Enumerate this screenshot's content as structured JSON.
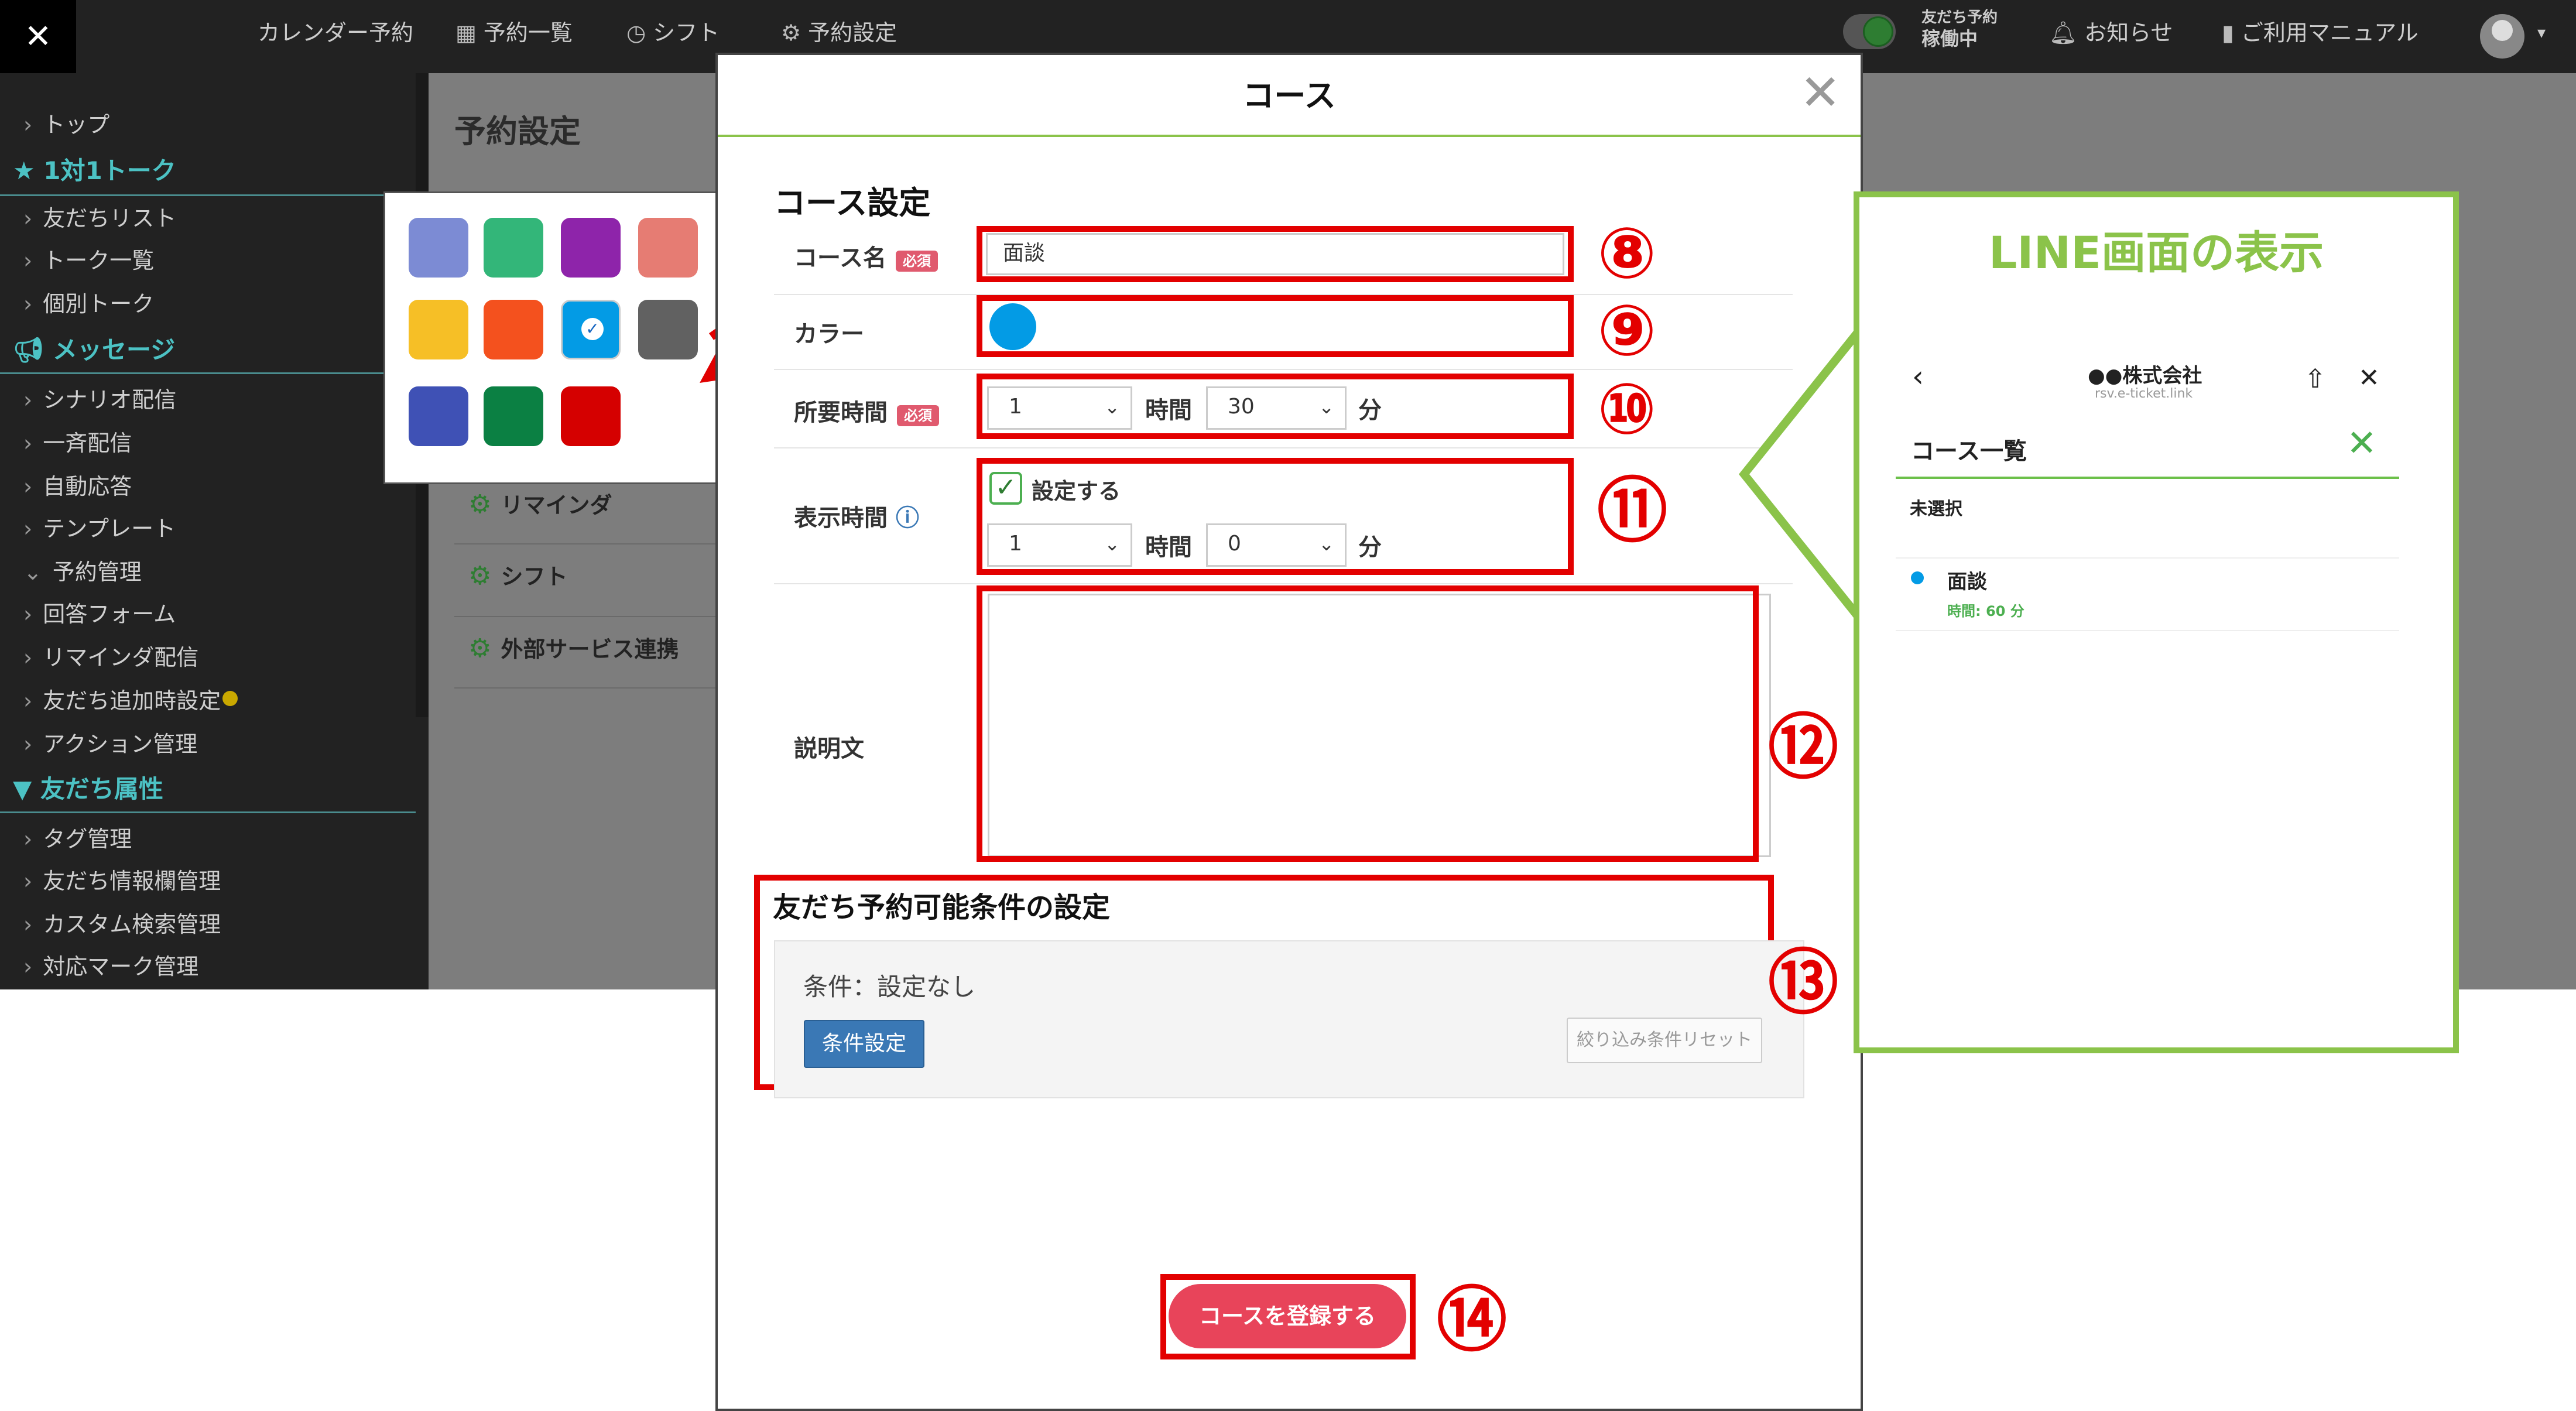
{
  "topbar": {
    "close_icon": "close-x-icon",
    "nav": [
      {
        "label": "カレンダー予約",
        "icon": ""
      },
      {
        "label": "予約一覧",
        "icon": "calendar-grid-icon"
      },
      {
        "label": "シフト",
        "icon": "clock-icon"
      },
      {
        "label": "予約設定",
        "icon": "gear-icon"
      }
    ],
    "status_line1": "友だち予約",
    "status_line2": "稼働中",
    "notice": "お知らせ",
    "manual": "ご利用マニュアル"
  },
  "sidebar": {
    "items_top": [
      "トップ"
    ],
    "section1": "1対1トーク",
    "section1_items": [
      "友だちリスト",
      "トーク一覧",
      "個別トーク"
    ],
    "section2": "メッセージ",
    "section2_items": [
      "シナリオ配信",
      "一斉配信",
      "自動応答",
      "テンプレート",
      "予約管理",
      "回答フォーム",
      "リマインダ配信",
      "友だち追加時設定",
      "アクション管理"
    ],
    "section3": "友だち属性",
    "section3_items": [
      "タグ管理",
      "友だち情報欄管理",
      "カスタム検索管理",
      "対応マーク管理"
    ]
  },
  "page": {
    "title": "予約設定",
    "settings_items": [
      "リマインダ",
      "シフト",
      "外部サービス連携"
    ]
  },
  "picker": {
    "colors": [
      "#7c8bd4",
      "#33b679",
      "#8e24aa",
      "#e67c73",
      "#f6bf26",
      "#f4511e",
      "#039be5",
      "#616161",
      "#3f51b5",
      "#0b8043",
      "#d50000"
    ],
    "selected_index": 6
  },
  "modal": {
    "title": "コース",
    "section_title": "コース設定",
    "course_name_label": "コース名",
    "required_badge": "必須",
    "course_name_value": "面談",
    "color_label": "カラー",
    "color_value": "#039be5",
    "duration_label": "所要時間",
    "duration_hours": "1",
    "hours_unit": "時間",
    "duration_minutes": "30",
    "minutes_unit": "分",
    "display_label": "表示時間",
    "display_checkbox_label": "設定する",
    "display_hours": "1",
    "display_minutes": "0",
    "description_label": "説明文",
    "cond_section_title": "友だち予約可能条件の設定",
    "cond_text": "条件：設定なし",
    "cond_button": "条件設定",
    "reset_button": "絞り込み条件リセット",
    "submit_button": "コースを登録する"
  },
  "annotations": [
    "⑧",
    "⑨",
    "⑩",
    "⑪",
    "⑫",
    "⑬",
    "⑭"
  ],
  "line_panel": {
    "title": "LINE画面の表示",
    "company": "●●株式会社",
    "domain": "rsv.e-ticket.link",
    "list_title": "コース一覧",
    "unselected": "未選択",
    "course_name": "面談",
    "course_time": "時間: 60 分",
    "accent": "#8bc34a"
  }
}
